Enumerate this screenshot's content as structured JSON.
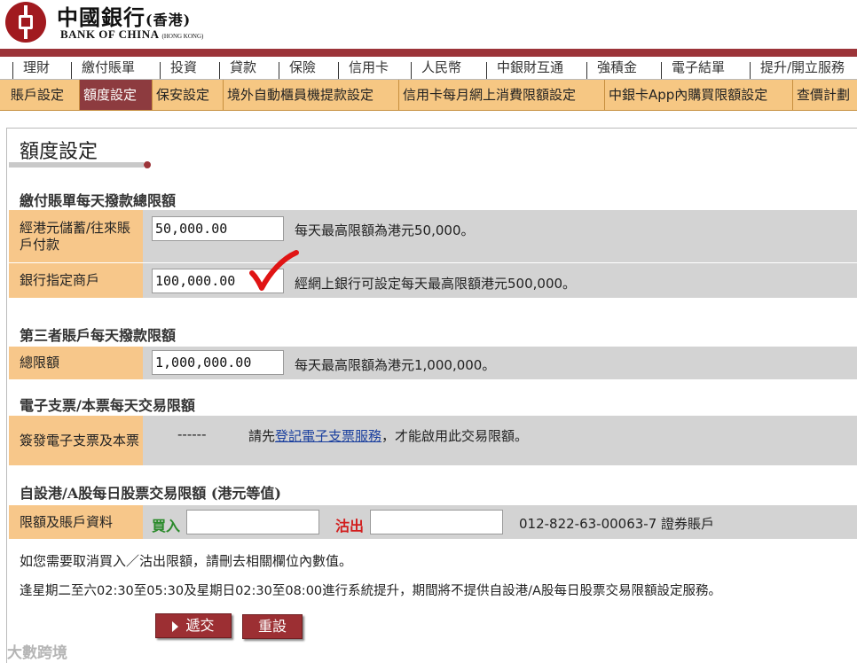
{
  "brand": {
    "cn_name": "中國銀行",
    "cn_sub": "(香港)",
    "en_name": "BANK OF CHINA",
    "en_sub": "(HONG KONG)",
    "brand_color": "#9c3439"
  },
  "main_nav": [
    "理財",
    "繳付賬單",
    "投資",
    "貸款",
    "保險",
    "信用卡",
    "人民幣",
    "中銀財互通",
    "強積金",
    "電子結單",
    "提升/開立服務"
  ],
  "sub_nav": {
    "items": [
      "賬戶設定",
      "額度設定",
      "保安設定",
      "境外自動櫃員機提款設定",
      "信用卡每月網上消費限額設定",
      "中銀卡App內購買限額設定",
      "查價計劃"
    ],
    "active": "額度設定"
  },
  "page": {
    "title": "額度設定"
  },
  "bill_payment": {
    "heading": "繳付賬單每天撥款總限額",
    "rows": [
      {
        "label": "經港元儲蓄/往來賬戶付款",
        "value": "50,000.00",
        "desc": "每天最高限額為港元50,000。"
      },
      {
        "label": "銀行指定商戶",
        "value": "100,000.00",
        "desc": "經網上銀行可設定每天最高限額港元500,000。"
      }
    ]
  },
  "third_party": {
    "heading": "第三者賬戶每天撥款限額",
    "label": "總限額",
    "value": "1,000,000.00",
    "desc": "每天最高限額為港元1,000,000。"
  },
  "echeque": {
    "heading": "電子支票/本票每天交易限額",
    "label": "簽發電子支票及本票",
    "dashes": "------",
    "desc_prefix": "請先",
    "desc_link": "登記電子支票服務",
    "desc_suffix": "，才能啟用此交易限額。"
  },
  "stock": {
    "heading": "自設港/A股每日股票交易限額 (港元等值)",
    "label": "限額及賬戶資料",
    "buy_label": "買入",
    "buy_value": "",
    "sell_label": "沽出",
    "sell_value": "",
    "account": "012-822-63-00063-7 證券賬戶"
  },
  "notes": {
    "cancel_note": "如您需要取消買入／沽出限額，請刪去相關欄位內數值。",
    "maintenance_note": "逢星期二至六02:30至05:30及星期日02:30至08:00進行系統提升，期間將不提供自設港/A股每日股票交易限額設定服務。"
  },
  "buttons": {
    "submit": "遞交",
    "reset": "重設"
  },
  "watermark": "大數跨境"
}
